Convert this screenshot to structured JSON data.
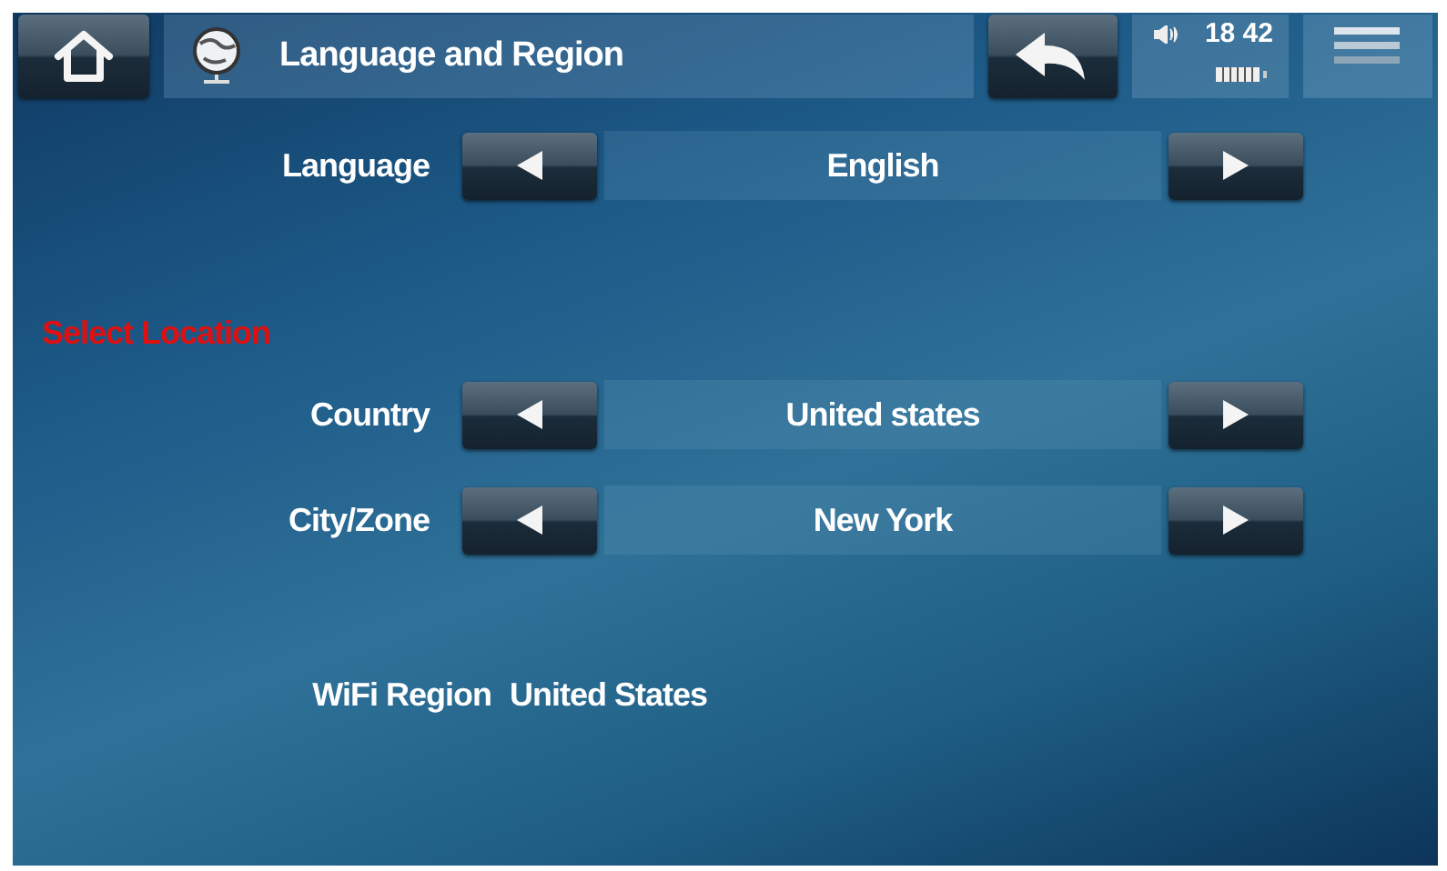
{
  "header": {
    "title": "Language and Region",
    "time": "18 42"
  },
  "language": {
    "label": "Language",
    "value": "English"
  },
  "section_heading": "Select Location",
  "location_rows": [
    {
      "label": "Country",
      "value": "United states"
    },
    {
      "label": "City/Zone",
      "value": "New York"
    }
  ],
  "wifi_region": {
    "label": "WiFi Region",
    "value": "United States"
  }
}
